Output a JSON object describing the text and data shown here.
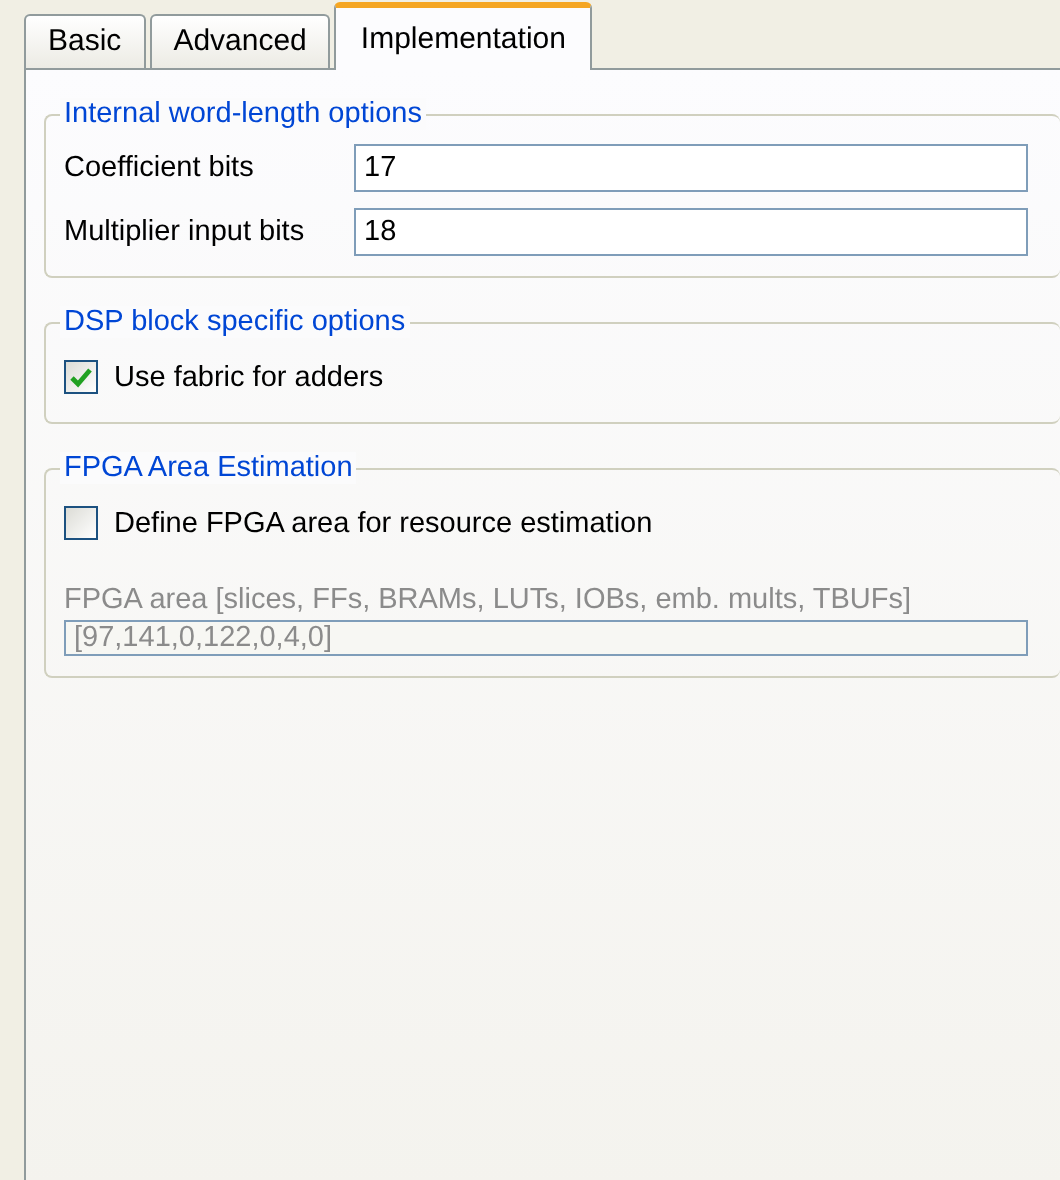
{
  "tabs": [
    {
      "label": "Basic",
      "selected": false
    },
    {
      "label": "Advanced",
      "selected": false
    },
    {
      "label": "Implementation",
      "selected": true
    }
  ],
  "groups": [
    {
      "title": "Internal word-length options",
      "items": [
        {
          "kind": "field",
          "label": "Coefficient bits",
          "value": "17",
          "disabled": false
        },
        {
          "kind": "field",
          "label": "Multiplier input bits",
          "value": "18",
          "disabled": false
        }
      ]
    },
    {
      "title": "DSP block specific options",
      "items": [
        {
          "kind": "checkbox",
          "label": "Use fabric for adders",
          "checked": true
        }
      ]
    },
    {
      "title": "FPGA Area Estimation",
      "items": [
        {
          "kind": "checkbox",
          "label": "Define FPGA area for resource estimation",
          "checked": false
        },
        {
          "kind": "stacked_field",
          "label": "FPGA area [slices, FFs, BRAMs, LUTs, IOBs, emb. mults, TBUFs]",
          "value": "[97,141,0,122,0,4,0]",
          "disabled": true
        }
      ]
    }
  ]
}
